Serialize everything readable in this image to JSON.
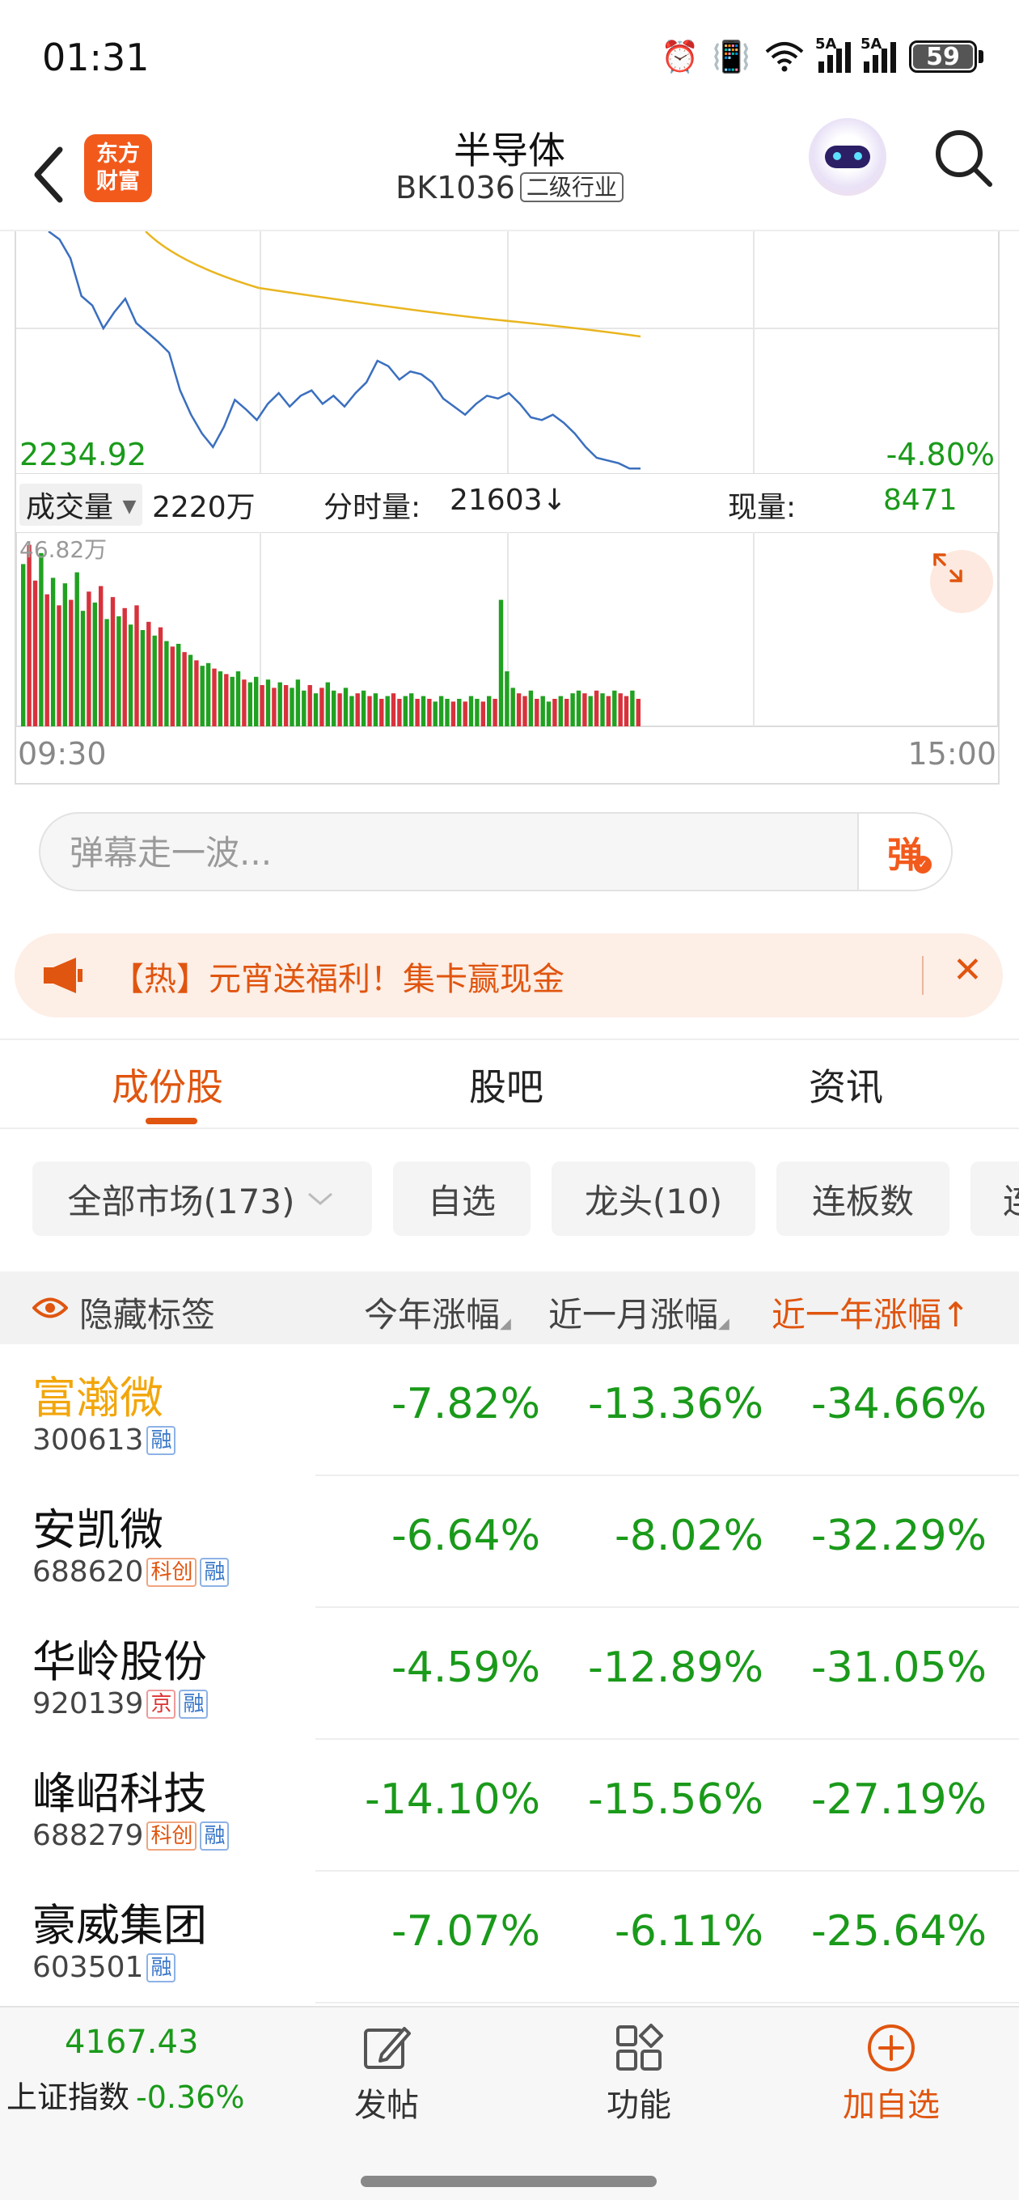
{
  "status_bar": {
    "time": "01:31",
    "battery": "59",
    "net1": "5A",
    "net2": "5A"
  },
  "header": {
    "title": "半导体",
    "code": "BK1036",
    "tag": "二级行业",
    "logo_line1": "东方",
    "logo_line2": "财富"
  },
  "chart": {
    "low_price": "2234.92",
    "change_pct": "-4.80%",
    "volume_select": "成交量",
    "total_volume": "2220万",
    "tick_volume_label": "分时量:",
    "tick_volume": "21603↓",
    "current_label": "现量:",
    "current_volume": "8471",
    "volume_max": "46.82万",
    "time_start": "09:30",
    "time_end": "15:00",
    "price_series": [
      0,
      6,
      20,
      48,
      55,
      72,
      60,
      50,
      68,
      75,
      82,
      90,
      118,
      136,
      150,
      160,
      145,
      125,
      132,
      140,
      128,
      120,
      130,
      122,
      118,
      128,
      122,
      130,
      120,
      112,
      96,
      100,
      110,
      104,
      106,
      112,
      124,
      130,
      136,
      128,
      122,
      124,
      120,
      128,
      138,
      140,
      136,
      142,
      150,
      160,
      168,
      170,
      172,
      176,
      176
    ],
    "volume_series": [
      118,
      132,
      106,
      126,
      96,
      108,
      88,
      104,
      92,
      112,
      84,
      98,
      90,
      102,
      78,
      94,
      80,
      86,
      74,
      88,
      70,
      76,
      66,
      72,
      62,
      58,
      60,
      54,
      52,
      48,
      44,
      46,
      42,
      40,
      38,
      36,
      40,
      34,
      32,
      36,
      30,
      34,
      28,
      32,
      30,
      28,
      34,
      26,
      30,
      24,
      28,
      32,
      26,
      24,
      28,
      22,
      24,
      26,
      22,
      24,
      20,
      22,
      24,
      20,
      22,
      24,
      20,
      22,
      20,
      18,
      22,
      20,
      18,
      20,
      18,
      22,
      20,
      18,
      22,
      20,
      92,
      40,
      28,
      24,
      22,
      26,
      20,
      22,
      18,
      20,
      22,
      20,
      24,
      26,
      24,
      22,
      26,
      24,
      22,
      26,
      24,
      22,
      26,
      20
    ],
    "volume_colors": "grrgrgrgrggrgrgrgrgrgrgrgrgrgrggrgrggrggrgrgrgggrgrggrggrgrgrgrrggrgrgggrgrggrgrgggrrgrggrgrggrgrgr"
  },
  "danmaku": {
    "placeholder": "弹幕走一波...",
    "button": "弹"
  },
  "banner": {
    "text": "【热】元宵送福利！集卡赢现金"
  },
  "tabs": [
    {
      "label": "成份股"
    },
    {
      "label": "股吧"
    },
    {
      "label": "资讯"
    }
  ],
  "filters": [
    {
      "label": "全部市场(173)"
    },
    {
      "label": "自选"
    },
    {
      "label": "龙头(10)"
    },
    {
      "label": "连板数"
    },
    {
      "label": "连"
    }
  ],
  "table": {
    "hide_label": "隐藏标签",
    "col1": "今年涨幅",
    "col2": "近一月涨幅",
    "col3": "近一年涨幅↑",
    "rows": [
      {
        "name": "富瀚微",
        "code": "300613",
        "badges": [
          "融"
        ],
        "ytd": "-7.82%",
        "m1": "-13.36%",
        "y1": "-34.66%"
      },
      {
        "name": "安凯微",
        "code": "688620",
        "badges": [
          "科创",
          "融"
        ],
        "ytd": "-6.64%",
        "m1": "-8.02%",
        "y1": "-32.29%"
      },
      {
        "name": "华岭股份",
        "code": "920139",
        "badges": [
          "京",
          "融"
        ],
        "ytd": "-4.59%",
        "m1": "-12.89%",
        "y1": "-31.05%"
      },
      {
        "name": "峰岹科技",
        "code": "688279",
        "badges": [
          "科创",
          "融"
        ],
        "ytd": "-14.10%",
        "m1": "-15.56%",
        "y1": "-27.19%"
      },
      {
        "name": "豪威集团",
        "code": "603501",
        "badges": [
          "融"
        ],
        "ytd": "-7.07%",
        "m1": "-6.11%",
        "y1": "-25.64%"
      }
    ]
  },
  "bottom_nav": {
    "index_value": "4167.43",
    "index_name": "上证指数",
    "index_pct": "-0.36%",
    "post": "发帖",
    "features": "功能",
    "add": "加自选"
  }
}
